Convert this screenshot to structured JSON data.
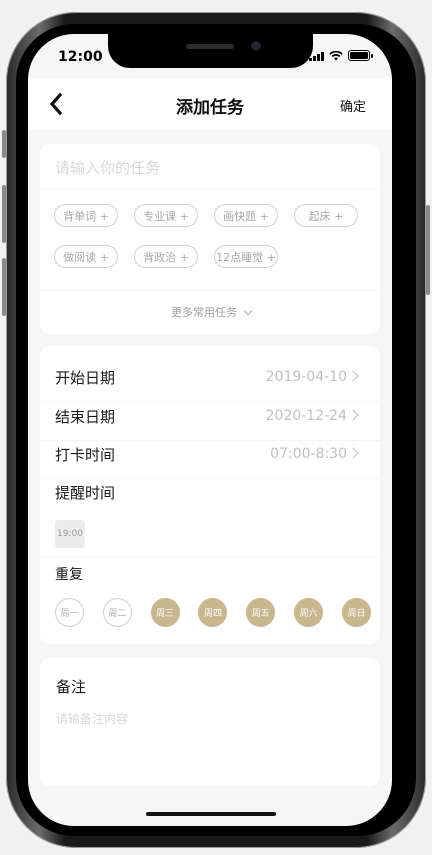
{
  "status_bar": {
    "time": "12:00"
  },
  "header": {
    "title": "添加任务",
    "confirm_label": "确定"
  },
  "task": {
    "placeholder": "请输入你的任务",
    "chips": [
      "背单词 +",
      "专业课 +",
      "画快题 +",
      "起床 +",
      "做阅读 +",
      "背政治 +",
      "12点睡觉 +"
    ],
    "more_label": "更多常用任务"
  },
  "schedule": {
    "start_label": "开始日期",
    "start_value": "2019-04-10",
    "end_label": "结束日期",
    "end_value": "2020-12-24",
    "checkin_label": "打卡时间",
    "checkin_value": "07:00-8:30",
    "reminder_label": "提醒时间",
    "reminder_value": "19:00",
    "repeat_label": "重复",
    "days": [
      {
        "label": "周一",
        "selected": false
      },
      {
        "label": "周二",
        "selected": false
      },
      {
        "label": "周三",
        "selected": true
      },
      {
        "label": "周四",
        "selected": true
      },
      {
        "label": "周五",
        "selected": true
      },
      {
        "label": "周六",
        "selected": true
      },
      {
        "label": "周日",
        "selected": true
      }
    ]
  },
  "note": {
    "label": "备注",
    "placeholder": "请输备注内容"
  },
  "colors": {
    "accent": "#c8b68f",
    "placeholder": "#d8d8d8"
  }
}
